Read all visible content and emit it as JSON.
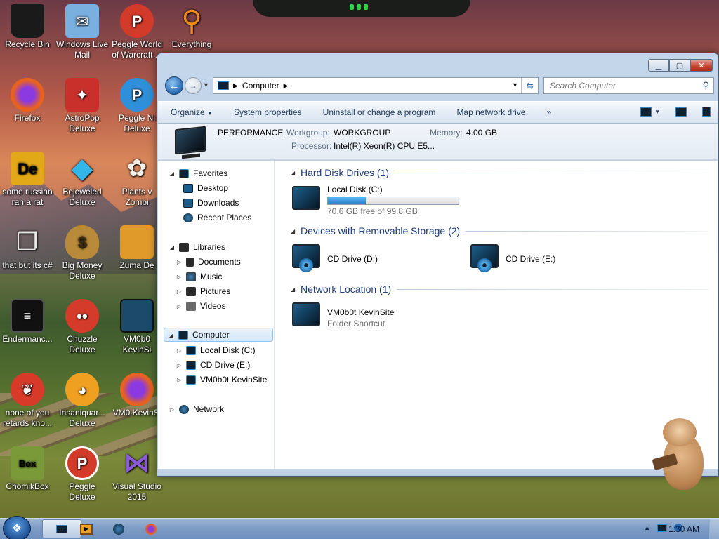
{
  "desktop": {
    "icons": [
      {
        "label": "Recycle Bin",
        "icon": "recycle-bin-icon",
        "color": "#1a1a1a"
      },
      {
        "label": "Windows Live Mail",
        "icon": "mail-icon",
        "color": "#7ab0e0"
      },
      {
        "label": "Peggle World of Warcraft ...",
        "icon": "peggle-icon",
        "color": "#d23a2a"
      },
      {
        "label": "Everything",
        "icon": "magnifier-icon",
        "color": "#f08a1a"
      },
      {
        "label": "Firefox",
        "icon": "firefox-icon",
        "color": "#e8621f"
      },
      {
        "label": "AstroPop Deluxe",
        "icon": "astropop-icon",
        "color": "#c9302c"
      },
      {
        "label": "Peggle Ni Deluxe",
        "icon": "peggle-icon",
        "color": "#2f8fd8"
      },
      {
        "label": "some russian ran a rat",
        "icon": "de-icon",
        "color": "#e2a817"
      },
      {
        "label": "Bejeweled Deluxe",
        "icon": "gem-icon",
        "color": "#33b6e8"
      },
      {
        "label": "Plants v Zombi",
        "icon": "flower-icon",
        "color": "#6aa83a"
      },
      {
        "label": "that but its c#",
        "icon": "copy-icon",
        "color": "#8d8d8d"
      },
      {
        "label": "Big Money Deluxe",
        "icon": "money-bag-icon",
        "color": "#b88a3a"
      },
      {
        "label": "Zuma De",
        "icon": "zuma-icon",
        "color": "#e09a2a"
      },
      {
        "label": "Endermanc...",
        "icon": "notepad-icon",
        "color": "#111111"
      },
      {
        "label": "Chuzzle Deluxe",
        "icon": "chuzzle-icon",
        "color": "#d43b2b"
      },
      {
        "label": "VM0b0 KevinSi",
        "icon": "monitor-icon",
        "color": "#1b4a6b"
      },
      {
        "label": "none of you retards kno...",
        "icon": "dragon-icon",
        "color": "#d83a2a"
      },
      {
        "label": "Insaniquar... Deluxe",
        "icon": "fish-icon",
        "color": "#f0a020"
      },
      {
        "label": "VM0 KevinSi",
        "icon": "firefox-icon",
        "color": "#e8621f"
      },
      {
        "label": "ChomikBox",
        "icon": "hamster-box-icon",
        "color": "#7a9a3a"
      },
      {
        "label": "Peggle Deluxe",
        "icon": "peggle-icon",
        "color": "#d23a2a"
      },
      {
        "label": "Visual Studio 2015",
        "icon": "visual-studio-icon",
        "color": "#6a3ab0"
      }
    ]
  },
  "window": {
    "address": {
      "crumb": "Computer"
    },
    "search": {
      "placeholder": "Search Computer"
    },
    "commands": [
      "Organize",
      "System properties",
      "Uninstall or change a program",
      "Map network drive"
    ],
    "more": "»",
    "details": {
      "name": "PERFORMANCE",
      "workgroup_label": "Workgroup:",
      "workgroup": "WORKGROUP",
      "memory_label": "Memory:",
      "memory": "4.00 GB",
      "processor_label": "Processor:",
      "processor": "Intel(R) Xeon(R) CPU E5..."
    },
    "nav": {
      "favorites": "Favorites",
      "desktop": "Desktop",
      "downloads": "Downloads",
      "recent": "Recent Places",
      "libraries": "Libraries",
      "documents": "Documents",
      "music": "Music",
      "pictures": "Pictures",
      "videos": "Videos",
      "computer": "Computer",
      "local_disk": "Local Disk (C:)",
      "cd_drive": "CD Drive (E:)",
      "vm": "VM0b0t KevinSite",
      "network": "Network"
    },
    "groups": {
      "hdd": "Hard Disk Drives (1)",
      "removable": "Devices with Removable Storage (2)",
      "network": "Network Location (1)"
    },
    "items": {
      "local_disk": {
        "name": "Local Disk (C:)",
        "free": "70.6 GB free of 99.8 GB",
        "used_fraction": 0.293
      },
      "cd_d": {
        "name": "CD Drive (D:)"
      },
      "cd_e": {
        "name": "CD Drive (E:)"
      },
      "vm": {
        "name": "VM0b0t KevinSite",
        "type": "Folder Shortcut"
      }
    }
  },
  "taskbar": {
    "clock": "1:30 AM",
    "tray_arrow": "▲"
  },
  "colors": {
    "accent": "#1e3b7a",
    "selection": "#d4e7fa",
    "bar_fill": "#2080c6"
  }
}
